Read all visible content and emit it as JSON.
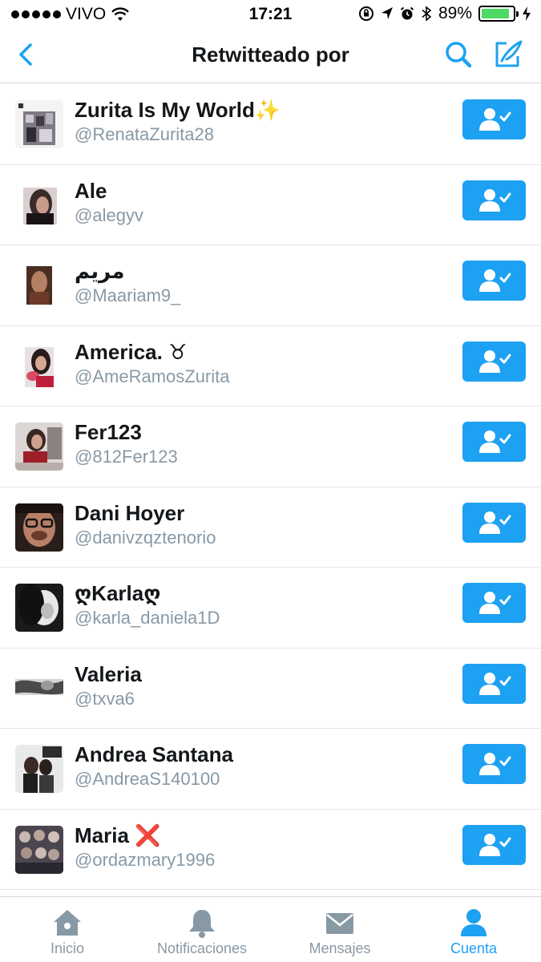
{
  "status_bar": {
    "carrier": "VIVO",
    "time": "17:21",
    "battery_percent": "89%",
    "battery_level": 0.89
  },
  "nav": {
    "title": "Retwitteado por",
    "back_icon": "chevron-left-icon",
    "search_icon": "search-icon",
    "compose_icon": "compose-icon"
  },
  "users": [
    {
      "name": "Zurita Is My World✨",
      "handle": "@RenataZurita28",
      "following": true
    },
    {
      "name": "Ale",
      "handle": "@alegyv",
      "following": true
    },
    {
      "name": "مريم",
      "handle": "@Maariam9_",
      "following": true
    },
    {
      "name": "America. ♉",
      "handle": "@AmeRamosZurita",
      "following": true
    },
    {
      "name": "Fer123",
      "handle": "@812Fer123",
      "following": true
    },
    {
      "name": "Dani Hoyer",
      "handle": "@danivzqztenorio",
      "following": true
    },
    {
      "name": "ღKarlaღ",
      "handle": "@karla_daniela1D",
      "following": true
    },
    {
      "name": "Valeria",
      "handle": "@txva6",
      "following": true
    },
    {
      "name": "Andrea Santana",
      "handle": "@AndreaS140100",
      "following": true
    },
    {
      "name": "Maria ❌",
      "handle": "@ordazmary1996",
      "following": true
    }
  ],
  "tabs": [
    {
      "label": "Inicio",
      "icon": "home-icon",
      "active": false
    },
    {
      "label": "Notificaciones",
      "icon": "bell-icon",
      "active": false
    },
    {
      "label": "Mensajes",
      "icon": "envelope-icon",
      "active": false
    },
    {
      "label": "Cuenta",
      "icon": "person-icon",
      "active": true
    }
  ],
  "colors": {
    "accent": "#1da1f2",
    "text": "#14171a",
    "muted": "#8899a6",
    "battery": "#4cd964"
  }
}
